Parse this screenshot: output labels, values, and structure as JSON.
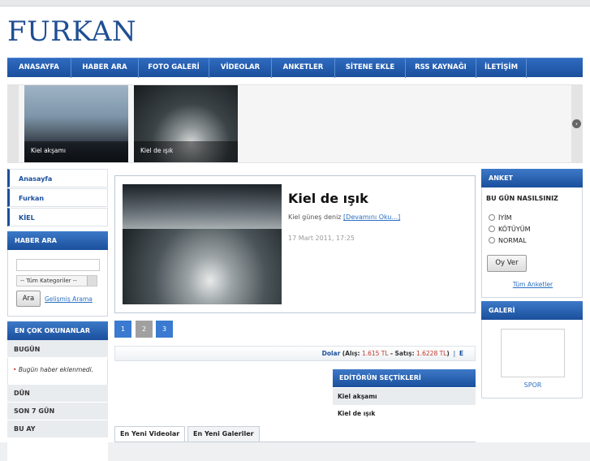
{
  "site": {
    "logo": "FURKAN"
  },
  "nav": [
    {
      "label": "ANASAYFA",
      "w": 79
    },
    {
      "label": "HABER ARA",
      "w": 83
    },
    {
      "label": "FOTO GALERİ",
      "w": 87
    },
    {
      "label": "VİDEOLAR",
      "w": 77
    },
    {
      "label": "ANKETLER",
      "w": 78
    },
    {
      "label": "SİTENE EKLE",
      "w": 87
    },
    {
      "label": "RSS KAYNAĞI",
      "w": 87
    },
    {
      "label": "İLETİŞİM",
      "w": 62
    }
  ],
  "slider": {
    "items": [
      {
        "caption": "Kiel akşamı"
      },
      {
        "caption": "Kiel de ışık"
      }
    ]
  },
  "left_nav": [
    "Anasayfa",
    "Furkan",
    "KİEL"
  ],
  "news_search": {
    "title": "HABER ARA",
    "category_value": "-- Tüm Kategoriler --",
    "button": "Ara",
    "advanced_link": "Gelişmiş Arama"
  },
  "most_read": {
    "title": "EN ÇOK OKUNANLAR",
    "today": "BUGÜN",
    "today_empty": "Bugün haber eklenmedi.",
    "yesterday": "DÜN",
    "last7": "SON 7 GÜN",
    "this_month": "BU AY"
  },
  "featured": {
    "title": "Kiel de ışık",
    "description": "Kiel güneş deniz",
    "more_link": "[Devamını Oku...]",
    "date": "17 Mart 2011, 17:25"
  },
  "pagination": [
    "1",
    "2",
    "3"
  ],
  "currency": {
    "name": "Dolar",
    "buy_label": "Alış:",
    "buy_value": "1.615 TL",
    "sell_label": "Satış:",
    "sell_value": "1.6228 TL",
    "next": "E"
  },
  "editor_picks": {
    "title": "EDİTÖRÜN SEÇTİKLERİ",
    "items": [
      "Kiel akşamı",
      "Kiel de ışık"
    ]
  },
  "tabs": [
    "En Yeni Videolar",
    "En Yeni Galeriler"
  ],
  "poll": {
    "title": "ANKET",
    "question": "BU GÜN NASILSINIZ",
    "options": [
      "İYİM",
      "KÖTÜYÜM",
      "NORMAL"
    ],
    "vote_button": "Oy Ver",
    "all_link": "Tüm Anketler"
  },
  "gallery": {
    "title": "GALERİ",
    "caption": "SPOR"
  },
  "colors": {
    "primary": "#1a4f9c",
    "accent_red": "#c0392b",
    "link": "#2a6fc2"
  }
}
